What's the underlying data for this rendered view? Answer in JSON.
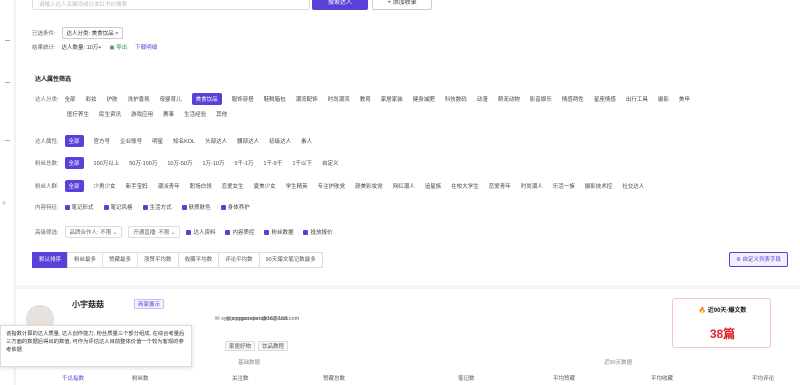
{
  "search": {
    "placeholder": "请输入达人关键词或日本红书ID搜索",
    "button": "搜索达人",
    "add": "+ 添加收录"
  },
  "filters": {
    "selected_label": "已选条件:",
    "selected_value": "达人分类: 美食饮品 ×",
    "result_label": "结果统计:",
    "result_value": "达人数量: 10万+",
    "export": "导出",
    "download": "下载明细"
  },
  "section_title": "达人属性筛选",
  "category": {
    "label": "达人分类:",
    "items": [
      "全部",
      "彩妆",
      "护肤",
      "洗护香氛",
      "母婴育儿",
      "美食饮品",
      "服饰穿搭",
      "鞋靴箱包",
      "潮流配饰",
      "时尚潮流",
      "教育",
      "家居家装",
      "健身减肥",
      "科技数码",
      "动漫",
      "萌宠动物",
      "影音娱乐",
      "情感两性",
      "星座情感",
      "出行工具",
      "摄影",
      "美甲",
      "医疗养生",
      "民生资讯",
      "游戏应用",
      "赛事",
      "生活经验",
      "其他"
    ],
    "active": "美食饮品"
  },
  "attribute": {
    "label": "达人属性:",
    "items": [
      "全部",
      "官方号",
      "企业账号",
      "明星",
      "知名KOL",
      "头部达人",
      "腰部达人",
      "初级达人",
      "素人"
    ],
    "active": "全部"
  },
  "fans": {
    "label": "粉丝总数:",
    "items": [
      "全部",
      "100万以上",
      "50万-100万",
      "10万-50万",
      "1万-10万",
      "5千-1万",
      "1千-5千",
      "1千以下",
      "自定义"
    ],
    "active": "全部"
  },
  "fan_persona": {
    "label": "粉丝人群:",
    "items": [
      "全部",
      "少男少女",
      "新手宝妈",
      "潮派青年",
      "职场白领",
      "恋爱女生",
      "夏美少女",
      "学生精英",
      "专注护肤党",
      "颜美彩妆党",
      "网红潮人",
      "追星族",
      "在校大学生",
      "恋爱青年",
      "时尚潮人",
      "乐活一族",
      "摄影技术控",
      "社交达人",
      "健身男女",
      "健身塑形"
    ],
    "active": "全部"
  },
  "content": {
    "label": "内容特征:",
    "items": [
      "笔记形式",
      "笔记风格",
      "生活方式",
      "肤质肤色",
      "身体养护"
    ]
  },
  "advanced": {
    "label": "高级筛选:",
    "dd1": "品牌合作人: 不限 ⌄",
    "dd2": "开通直播: 不限 ⌄",
    "items": [
      "达人资料",
      "内容质控",
      "粉丝数据",
      "投放报价"
    ]
  },
  "sort": {
    "items": [
      "默认排序",
      "粉丝最多",
      "赞藏最多",
      "涨赞平均数",
      "收藏平均数",
      "评论平均数",
      "90天爆文笔记数最多"
    ],
    "active": "默认排序",
    "custom": "自定义列表字段"
  },
  "card": {
    "name": "小宇菇菇",
    "showcase": "商家展示",
    "email_line": "xyggcooperation@163.com",
    "email_line2": "xyggcooperation@163.com",
    "tags": [
      "家居好物",
      "饮品教程"
    ],
    "tooltip": "该指数计算的达人质量, 达人创作能力, 粉丝质量三个部分组成, 在综合考量后三方面的数据后得出的数值, 可作为评估达人目前整体价值一个较为客观的参考依据",
    "col_basic": "基础数据",
    "col_90": "近90天数据",
    "stats": [
      "千瓜指数",
      "粉丝数",
      "关注数",
      "赞藏总数",
      "笔记数",
      "平均赞藏",
      "平均收藏",
      "平均评论"
    ],
    "hot_title": "近90天-爆文数",
    "hot_value": "38篇"
  }
}
